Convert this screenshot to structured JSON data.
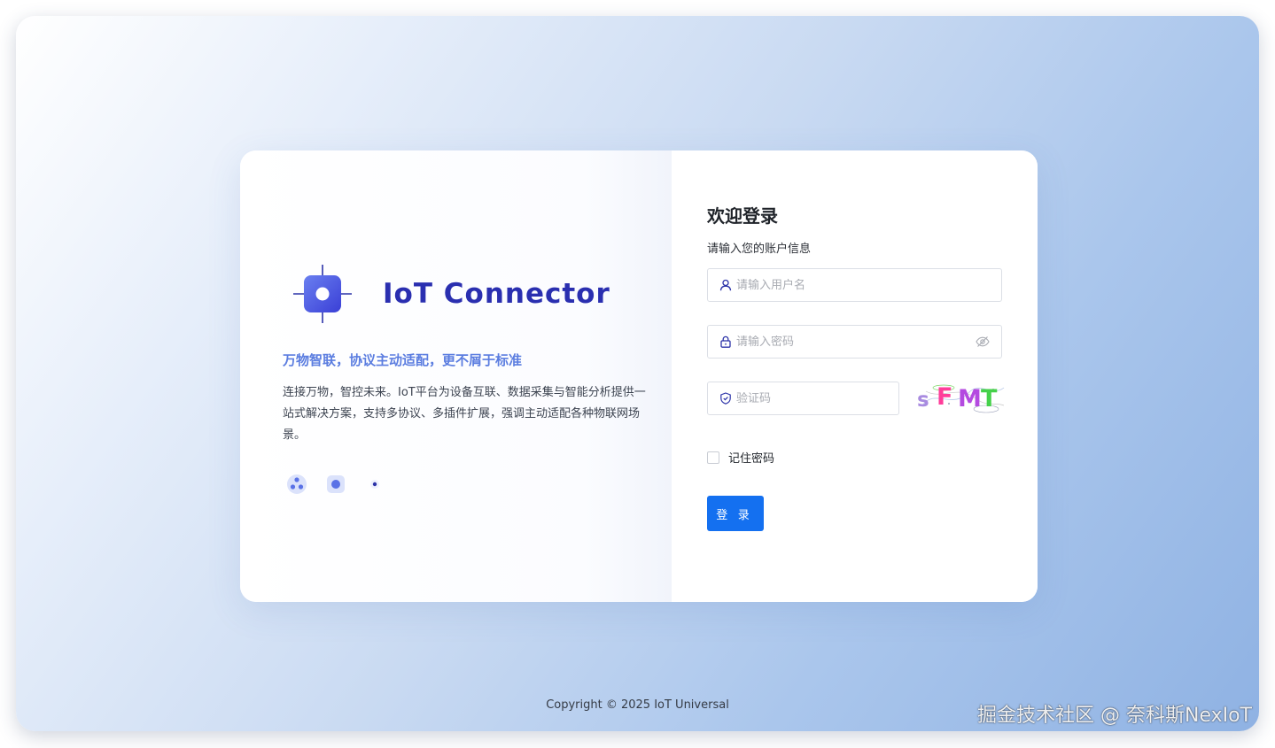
{
  "brand": {
    "name": "IoT Connector",
    "slogan": "万物智联，协议主动适配，更不屑于标准",
    "description": "连接万物，智控未来。IoT平台为设备互联、数据采集与智能分析提供一站式解决方案，支持多协议、多插件扩展，强调主动适配各种物联网场景。"
  },
  "login": {
    "title": "欢迎登录",
    "subtitle": "请输入您的账户信息",
    "username_placeholder": "请输入用户名",
    "password_placeholder": "请输入密码",
    "captcha_placeholder": "验证码",
    "captcha_text": "sFMT",
    "remember_label": "记住密码",
    "submit_label": "登 录"
  },
  "footer": {
    "copyright": "Copyright © 2025 IoT Universal"
  },
  "watermark": "掘金技术社区 @ 奈科斯NexIoT",
  "colors": {
    "primary": "#1470f0",
    "brand_text": "#2a2fb0",
    "slogan": "#5b7de0"
  },
  "icons": {
    "logo": "chip-crosshair-icon",
    "username": "user-icon",
    "password": "lock-icon",
    "captcha": "shield-icon",
    "password_toggle": "eye-off-icon",
    "features": [
      "connect-dots-icon",
      "device-square-icon",
      "dot-icon"
    ]
  }
}
